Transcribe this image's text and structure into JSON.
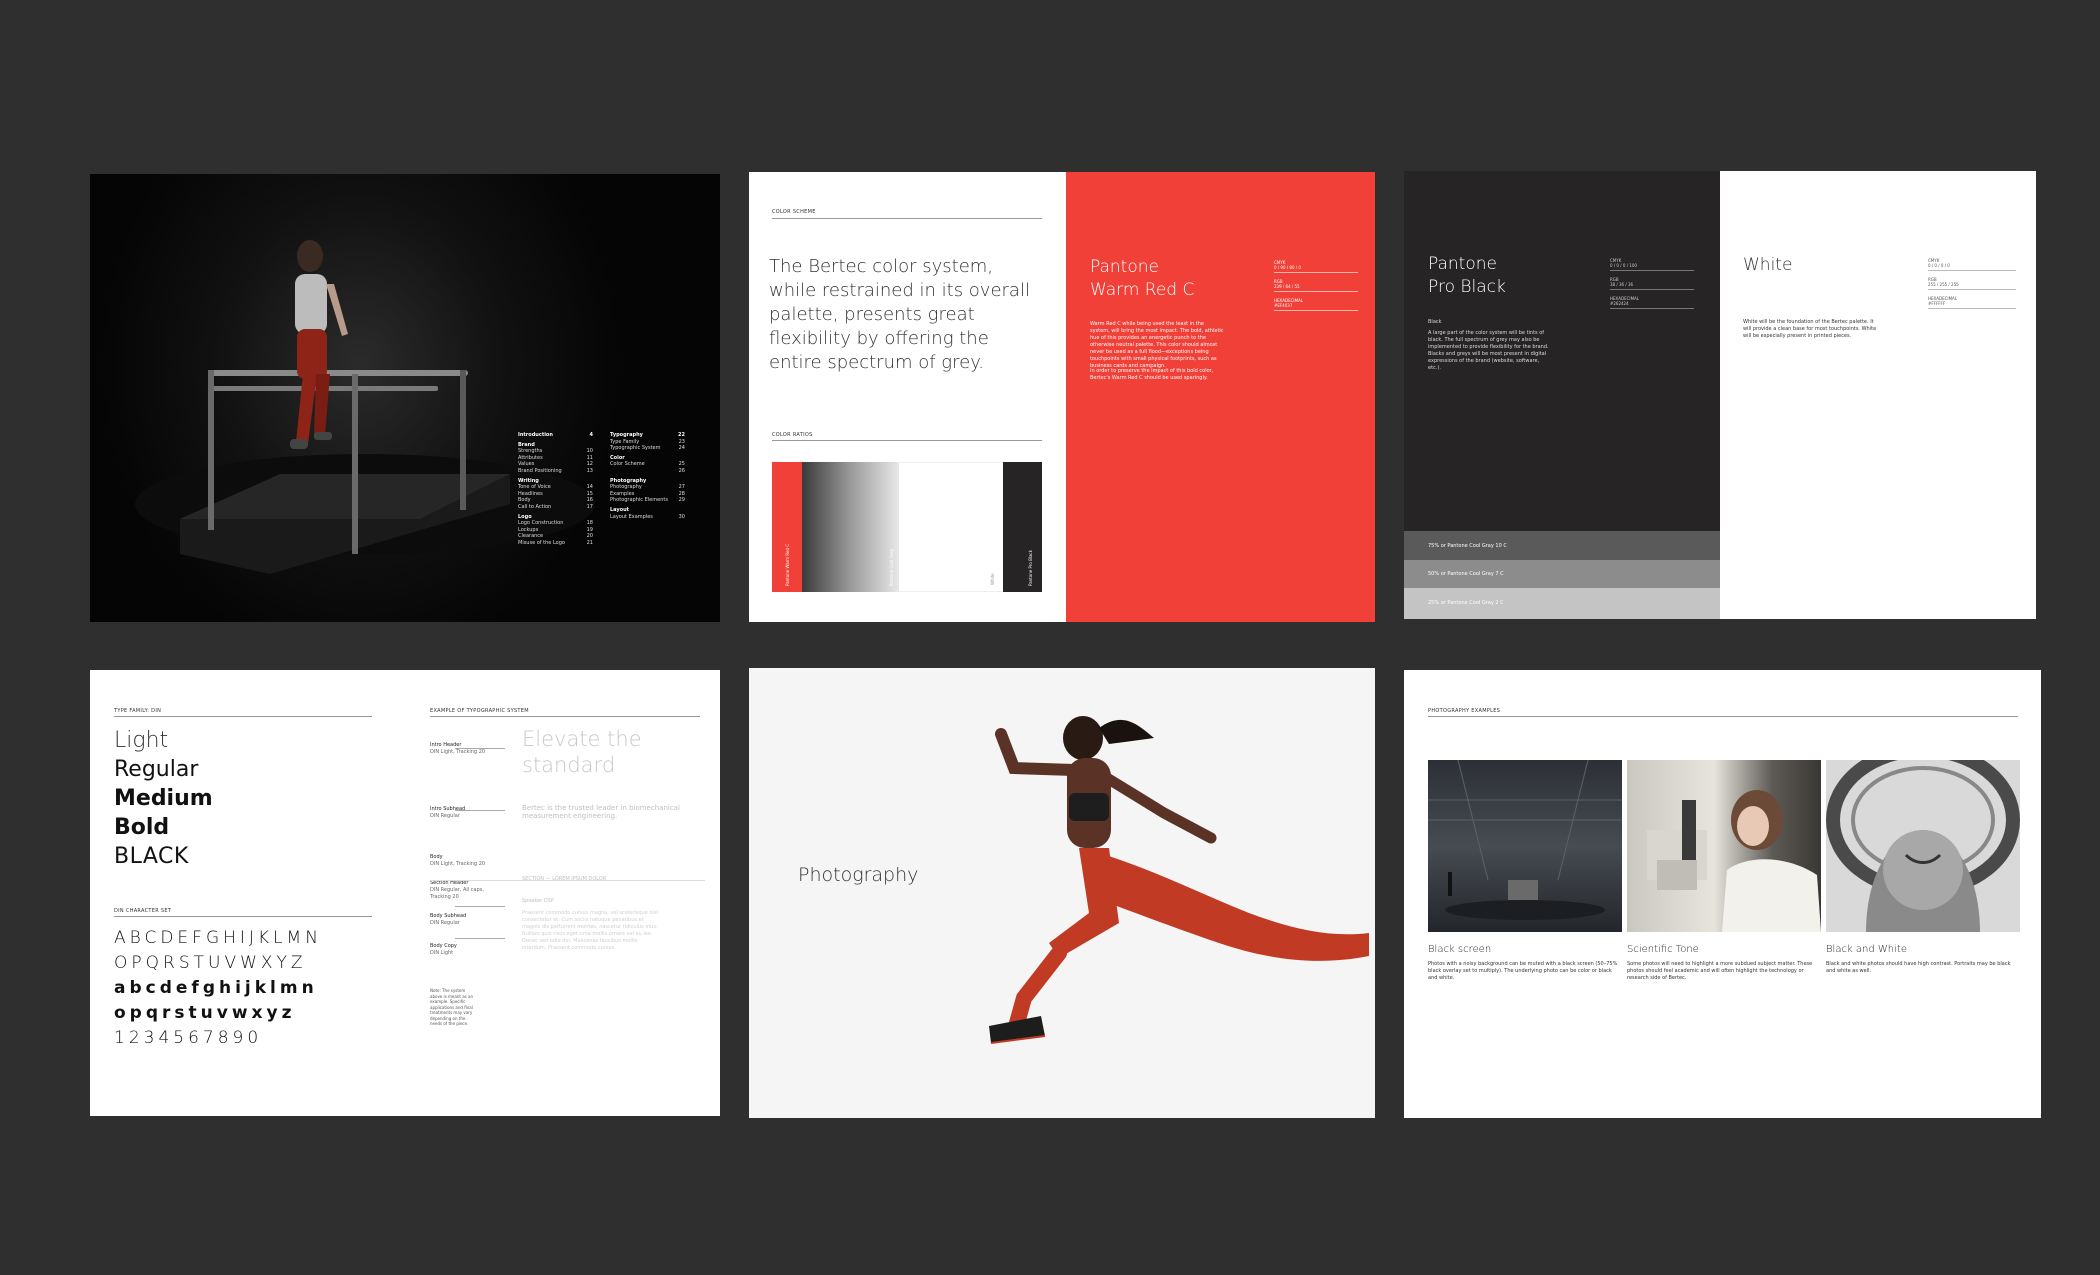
{
  "pages": {
    "cover": {
      "toc_col1": [
        {
          "label": "Introduction",
          "num": "4",
          "head": true
        },
        {
          "label": "Brand",
          "num": "",
          "head": true
        },
        {
          "label": "Strengths",
          "num": "10"
        },
        {
          "label": "Attributes",
          "num": "11"
        },
        {
          "label": "Values",
          "num": "12"
        },
        {
          "label": "Brand Positioning",
          "num": "13"
        },
        {
          "label": "Writing",
          "num": "",
          "head": true
        },
        {
          "label": "Tone of Voice",
          "num": "14"
        },
        {
          "label": "Headlines",
          "num": "15"
        },
        {
          "label": "Body",
          "num": "16"
        },
        {
          "label": "Call to Action",
          "num": "17"
        },
        {
          "label": "Logo",
          "num": "",
          "head": true
        },
        {
          "label": "Logo Construction",
          "num": "18"
        },
        {
          "label": "Lockups",
          "num": "19"
        },
        {
          "label": "Clearance",
          "num": "20"
        },
        {
          "label": "Misuse of the Logo",
          "num": "21"
        }
      ],
      "toc_col2": [
        {
          "label": "Typography",
          "num": "22",
          "head": true
        },
        {
          "label": "Type Family",
          "num": "23"
        },
        {
          "label": "Typographic System",
          "num": "24"
        },
        {
          "label": "Color",
          "num": "",
          "head": true
        },
        {
          "label": "Color Scheme",
          "num": "25"
        },
        {
          "label": "",
          "num": "26"
        },
        {
          "label": "Photography",
          "num": "",
          "head": true
        },
        {
          "label": "Photography",
          "num": "27"
        },
        {
          "label": "Examples",
          "num": "28"
        },
        {
          "label": "Photographic Elements",
          "num": "29"
        },
        {
          "label": "Layout",
          "num": "",
          "head": true
        },
        {
          "label": "Layout Examples",
          "num": "30"
        }
      ]
    },
    "color": {
      "section_label": "COLOR SCHEME",
      "intro": "The Bertec color system, while restrained in its overall palette, presents great flexibility by offering the entire spectrum of grey.",
      "ratios_label": "COLOR RATIOS",
      "swatch_labels": [
        "Pantone Warm Red C",
        "Pantone Cool Grey",
        "White",
        "Pantone Pro Black"
      ],
      "red_title_1": "Pantone",
      "red_title_2": "Warm Red C",
      "red_body_1": "Warm Red C while being used the least in the system, will bring the most impact. The bold, athletic hue of this provides an energetic punch to the otherwise neutral palette. This color should almost never be used as a full flood—exceptions being touchpoints with small physical footprints, such as business cards and campaign.",
      "red_body_2": "In order to preserve the impact of this bold color, Bertec's Warm Red C should be used sparingly.",
      "specs": [
        {
          "k": "CMYK",
          "v": "0 / 90 / 80 / 0"
        },
        {
          "k": "RGB",
          "v": "239 / 64 / 55"
        },
        {
          "k": "HEXADECIMAL",
          "v": "#EF4037"
        }
      ],
      "colors": {
        "red": "#f04037",
        "black": "#262424"
      }
    },
    "black": {
      "title_1": "Pantone",
      "title_2": "Pro Black",
      "sub": "Black",
      "body": "A large part of the color system will be tints of black. The full spectrum of grey may also be implemented to provide flexibility for the brand. Blacks and greys will be most present in digital expressions of the brand (website, software, etc.).",
      "specs": [
        {
          "k": "CMYK",
          "v": "0 / 0 / 0 / 100"
        },
        {
          "k": "RGB",
          "v": "38 / 36 / 36"
        },
        {
          "k": "HEXADECIMAL",
          "v": "#262424"
        }
      ],
      "tints": [
        "75% or Pantone Cool Gray 10 C",
        "50% or Pantone Cool Gray 7 C",
        "25% or Pantone Cool Gray 2 C"
      ],
      "white_title": "White",
      "white_body": "White will be the foundation of the Bertec palette. It will provide a clean base for most touchpoints. White will be especially present in printed pieces.",
      "white_specs": [
        {
          "k": "CMYK",
          "v": "0 / 0 / 0 / 0"
        },
        {
          "k": "RGB",
          "v": "255 / 255 / 255"
        },
        {
          "k": "HEXADECIMAL",
          "v": "#FFFFFF"
        }
      ]
    },
    "type": {
      "family_label": "TYPE FAMILY: DIN",
      "weights": [
        "Light",
        "Regular",
        "Medium",
        "Bold",
        "BLACK"
      ],
      "charset_label": "DIN CHARACTER SET",
      "charset": [
        "ABCDEFGHIJKLMN",
        "OPQRSTUVWXYZ",
        "abcdefghijklmn",
        "opqrstuvwxyz",
        "1234567890"
      ],
      "system_label": "EXAMPLE OF TYPOGRAPHIC SYSTEM",
      "rows": [
        {
          "k": "Intro Header",
          "v": "DIN Light, Tracking 20"
        },
        {
          "k": "Intro Subhead",
          "v": "DIN Regular"
        },
        {
          "k": "Body",
          "v": "DIN Light, Tracking 20"
        },
        {
          "k": "Section Header",
          "v": "DIN Regular, All caps, Tracking 20"
        },
        {
          "k": "Body Subhead",
          "v": "DIN Regular"
        },
        {
          "k": "Body Copy",
          "v": "DIN Light"
        }
      ],
      "example_header": "Elevate the standard",
      "example_sub": "Bertec is the trusted leader in biomechanical measurement engineering.",
      "example_section": "SECTION — LOREM IPSUM DOLOR",
      "example_subhead": "Speaker DSP",
      "example_body": "Praesent commodo cursus magna, vel scelerisque nisl consectetur et. Cum sociis natoque penatibus et magnis dis parturient montes, nascetur ridiculus mus. Nullam quis risus eget urna mollis ornare vel eu leo. Donec sed odio dui. Maecenas faucibus mollis interdum. Praesent commodo cursus.",
      "note": "Note: The system above is meant as an example. Specific applications and final treatments may vary depending on the needs of the piece."
    },
    "photo_divider": {
      "title": "Photography"
    },
    "photo_examples": {
      "section_label": "PHOTOGRAPHY EXAMPLES",
      "items": [
        {
          "title": "Black screen",
          "body": "Photos with a noisy background can be muted with a black screen (50–75% black overlay set to multiply). The underlying photo can be color or black and white."
        },
        {
          "title": "Scientific Tone",
          "body": "Some photos will need to highlight a more subdued subject matter. These photos should feel academic and will often highlight the technology or research side of Bertec."
        },
        {
          "title": "Black and White",
          "body": "Black and white photos should have high contrast. Portraits may be black and white as well."
        }
      ]
    }
  }
}
